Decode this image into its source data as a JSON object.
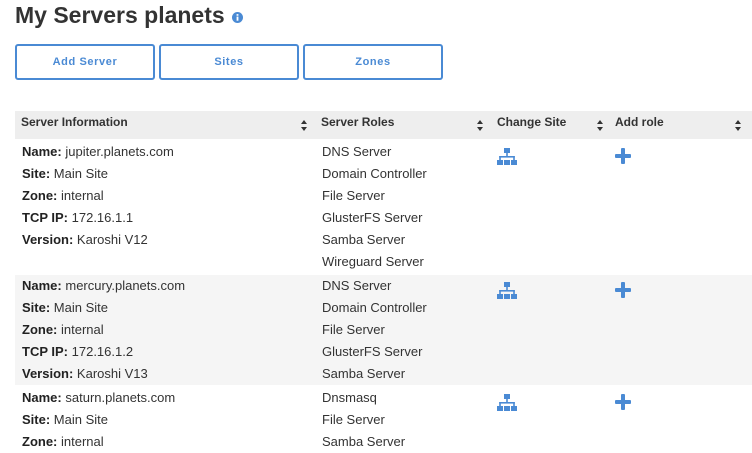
{
  "page": {
    "title": "My Servers planets",
    "info_icon": "info-circle-icon",
    "accent": "#4a8ad4"
  },
  "toolbar": {
    "add_server": "Add Server",
    "sites": "Sites",
    "zones": "Zones"
  },
  "table": {
    "headers": {
      "info": "Server Information",
      "roles": "Server Roles",
      "change_site": "Change Site",
      "add_role": "Add role"
    },
    "labels": {
      "name": "Name:",
      "site": "Site:",
      "zone": "Zone:",
      "tcp_ip": "TCP IP:",
      "version": "Version:"
    },
    "rows": [
      {
        "name": "jupiter.planets.com",
        "site": "Main Site",
        "zone": "internal",
        "tcp_ip": "172.16.1.1",
        "version": "Karoshi V12",
        "roles": [
          "DNS Server",
          "Domain Controller",
          "File Server",
          "GlusterFS Server",
          "Samba Server",
          "Wireguard Server"
        ]
      },
      {
        "name": "mercury.planets.com",
        "site": "Main Site",
        "zone": "internal",
        "tcp_ip": "172.16.1.2",
        "version": "Karoshi V13",
        "roles": [
          "DNS Server",
          "Domain Controller",
          "File Server",
          "GlusterFS Server",
          "Samba Server"
        ]
      },
      {
        "name": "saturn.planets.com",
        "site": "Main Site",
        "zone": "internal",
        "roles": [
          "Dnsmasq",
          "File Server",
          "Samba Server"
        ]
      }
    ],
    "icons": {
      "change_site": "sitemap-icon",
      "add_role": "plus-icon"
    }
  }
}
